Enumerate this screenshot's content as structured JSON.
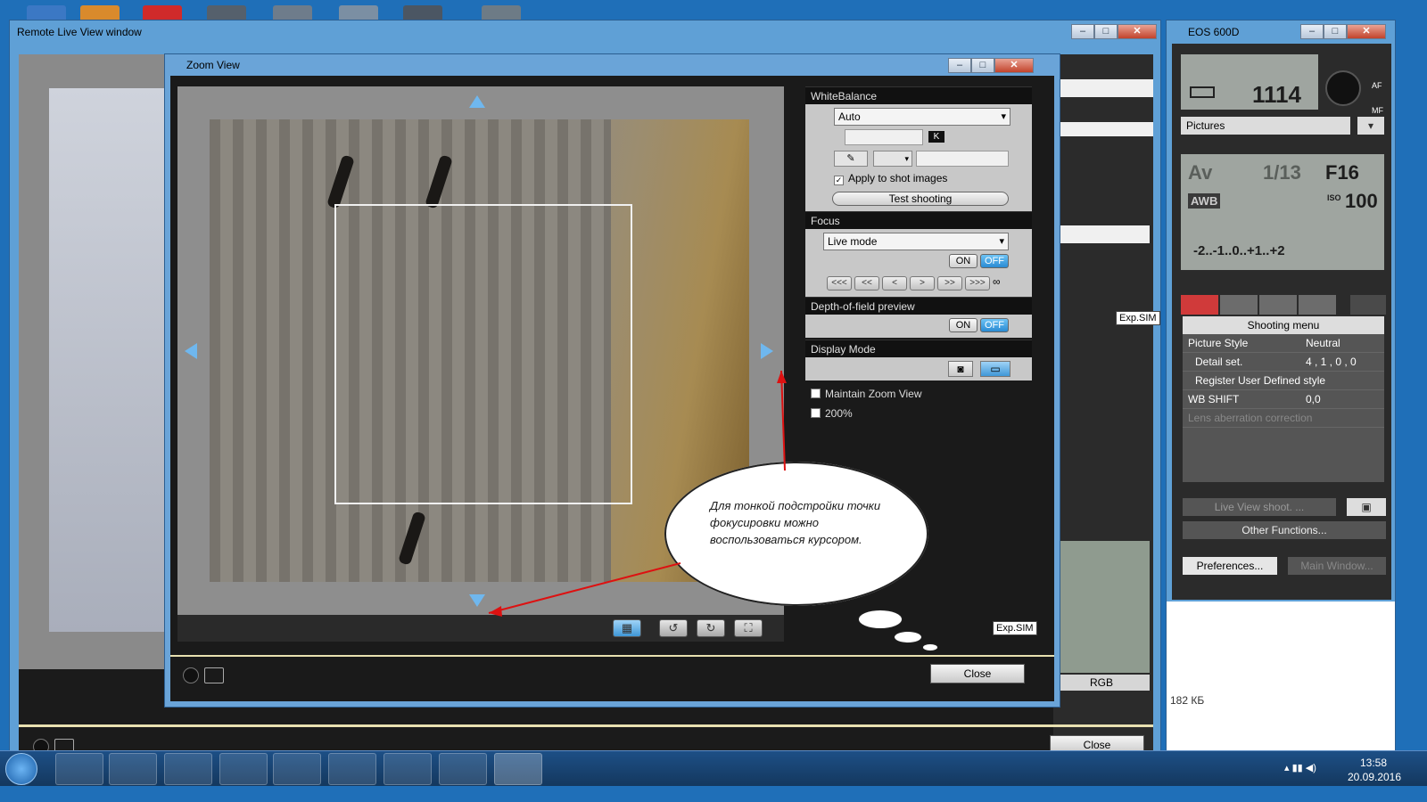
{
  "main_window": {
    "title": "Remote Live View window",
    "close_label": "Close",
    "file_size": "182 КБ",
    "rgb_label": "RGB",
    "exp_sim": "Exp.SIM"
  },
  "zoom_window": {
    "title": "Zoom View",
    "close_label": "Close",
    "exp_sim": "Exp.SIM",
    "white_balance": {
      "header": "WhiteBalance",
      "mode": "Auto",
      "kelvin_badge": "K",
      "apply_label": "Apply to shot images",
      "apply_checked": true,
      "test_label": "Test shooting"
    },
    "focus": {
      "header": "Focus",
      "mode": "Live mode",
      "on": "ON",
      "off": "OFF",
      "nav": [
        "<<<",
        "<<",
        "<",
        ">",
        ">>",
        ">>>"
      ],
      "infinity": "∞"
    },
    "dof": {
      "header": "Depth-of-field preview",
      "on": "ON",
      "off": "OFF"
    },
    "display_mode": {
      "header": "Display Mode"
    },
    "maintain_zoom": "Maintain Zoom View",
    "zoom_200": "200%"
  },
  "callout": {
    "text": "Для тонкой подстройки точки фокусировки можно воспользоваться курсором."
  },
  "eos": {
    "title": "EOS 600D",
    "shots_left": "1114",
    "folder": "Pictures",
    "mode": "Av",
    "shutter": "1/13",
    "aperture": "F16",
    "wb": "AWB",
    "iso_label": "ISO",
    "iso": "100",
    "exp_scale": "-2..-1..0..+1..+2",
    "af_label": "AF",
    "mf_label": "MF",
    "menu_title": "Shooting menu",
    "menu_rows": [
      {
        "label": "Picture Style",
        "value": "Neutral"
      },
      {
        "label": "Detail set.",
        "value": "4 , 1 , 0 , 0"
      },
      {
        "label": "Register User Defined style",
        "value": ""
      },
      {
        "label": "WB SHIFT",
        "value": "0,0"
      },
      {
        "label": "Lens aberration correction",
        "value": ""
      }
    ],
    "live_view_shoot": "Live View shoot. ...",
    "other_functions": "Other Functions...",
    "preferences": "Preferences...",
    "main_window": "Main Window..."
  },
  "taskbar": {
    "time": "13:58",
    "date": "20.09.2016"
  }
}
